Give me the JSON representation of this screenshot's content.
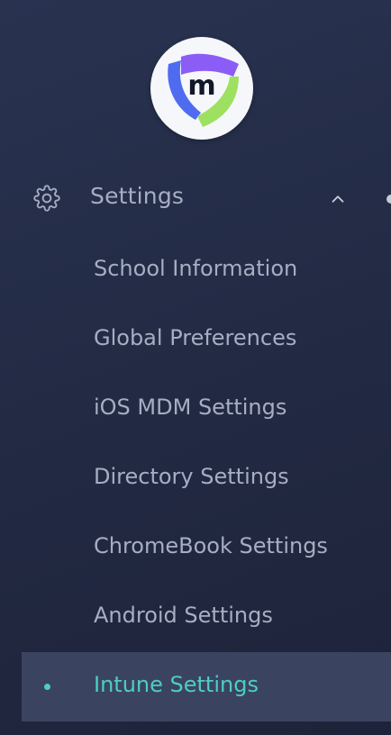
{
  "logo": {
    "letter": "m",
    "colors": {
      "purple": "#8b5cf6",
      "blue": "#4f6cf0",
      "green": "#9ee060"
    }
  },
  "sidebar": {
    "section": {
      "label": "Settings",
      "icon": "gear-icon",
      "toggle_icon": "chevron-up-icon",
      "expanded": true
    },
    "items": [
      {
        "label": "School Information"
      },
      {
        "label": "Global Preferences"
      },
      {
        "label": "iOS MDM Settings"
      },
      {
        "label": "Directory Settings"
      },
      {
        "label": "ChromeBook Settings"
      },
      {
        "label": "Android Settings"
      },
      {
        "label": "Intune Settings",
        "active": true
      }
    ]
  },
  "colors": {
    "text": "#a7aec3",
    "active_text": "#4ecdc4",
    "active_bg": "#3a4460"
  }
}
